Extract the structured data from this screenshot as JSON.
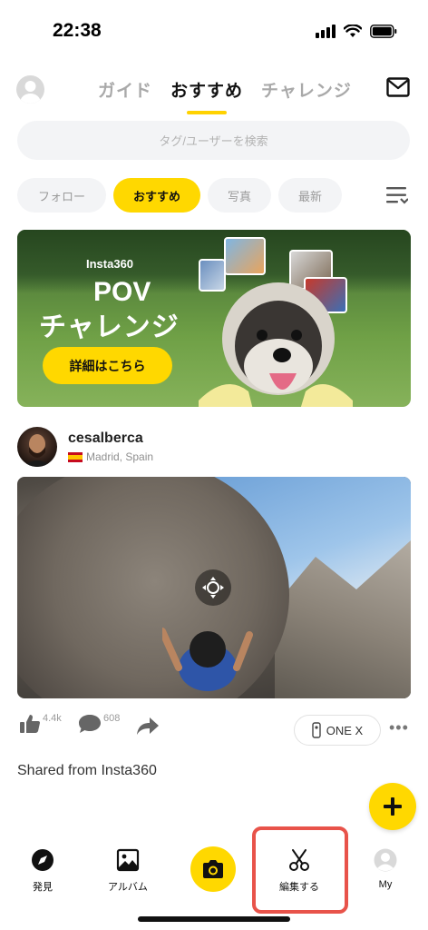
{
  "status_bar": {
    "time": "22:38"
  },
  "top_nav": {
    "tabs": [
      {
        "label": "ガイド",
        "active": false
      },
      {
        "label": "おすすめ",
        "active": true
      },
      {
        "label": "チャレンジ",
        "active": false
      }
    ]
  },
  "search": {
    "placeholder": "タグ/ユーザーを検索"
  },
  "filters": [
    {
      "label": "フォロー",
      "active": false
    },
    {
      "label": "おすすめ",
      "active": true
    },
    {
      "label": "写真",
      "active": false
    },
    {
      "label": "最新",
      "active": false
    }
  ],
  "banner": {
    "brand": "Insta360",
    "title": "POV",
    "subtitle": "チャレンジ",
    "button": "詳細はこちら"
  },
  "post": {
    "username": "cesalberca",
    "location": "Madrid, Spain",
    "likes": "4.4k",
    "comments": "608",
    "device": "ONE X",
    "caption": "Shared from Insta360"
  },
  "bottom_nav": {
    "discover": "発見",
    "album": "アルバム",
    "edit": "編集する",
    "my": "My"
  },
  "colors": {
    "accent": "#ffd800",
    "highlight": "#e8534a"
  }
}
